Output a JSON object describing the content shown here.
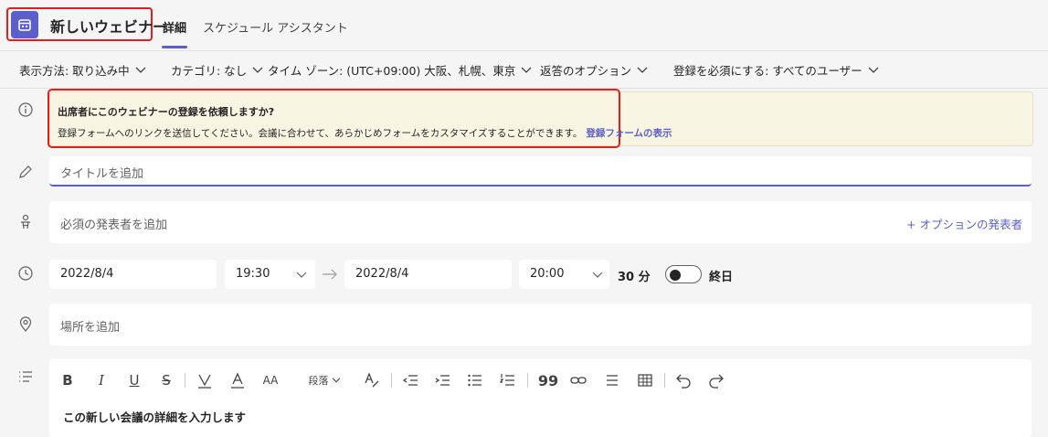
{
  "header": {
    "title": "新しいウェビナー",
    "tabs": [
      {
        "label": "詳細",
        "active": true
      },
      {
        "label": "スケジュール アシスタント",
        "active": false
      }
    ]
  },
  "options": {
    "display": "表示方法: 取り込み中",
    "category": "カテゴリ: なし",
    "timezone": "タイム ゾーン: (UTC+09:00) 大阪、札幌、東京",
    "reply": "返答のオプション",
    "registration": "登録を必須にする: すべてのユーザー"
  },
  "banner": {
    "title": "出席者にこのウェビナーの登録を依頼しますか?",
    "text": "登録フォームへのリンクを送信してください。会議に合わせて、あらかじめフォームをカスタマイズすることができます。",
    "link": "登録フォームの表示"
  },
  "form": {
    "title_placeholder": "タイトルを追加",
    "presenter_placeholder": "必須の発表者を追加",
    "optional_presenter": "+ オプションの発表者",
    "start_date": "2022/8/4",
    "start_time": "19:30",
    "end_date": "2022/8/4",
    "end_time": "20:00",
    "duration": "30 分",
    "all_day": "終日",
    "all_day_on": false,
    "location_placeholder": "場所を追加",
    "paragraph": "段落",
    "editor_placeholder": "この新しい会議の詳細を入力します"
  },
  "colors": {
    "accent": "#5b5fc7",
    "highlight_border": "#e02020",
    "banner_bg": "#f8f5e3"
  }
}
